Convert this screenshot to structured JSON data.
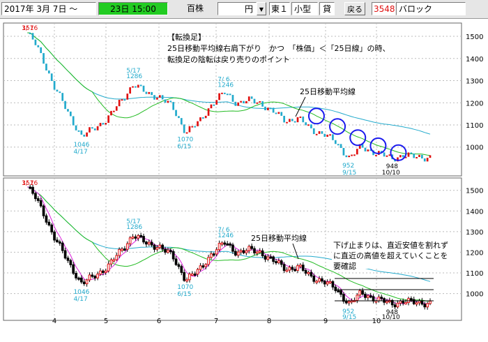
{
  "toolbar": {
    "date_text": "2017年  3月  7日 ～",
    "time_text": "23日 15:00",
    "time_bg": "#22cc22",
    "unit_label": "百株",
    "price_unit": "円",
    "dropdown_arrow": "▼",
    "market": "東１",
    "size_class": "小型",
    "lending": "貸",
    "back_button": "戻る",
    "code": "3548",
    "name": "バロック"
  },
  "colors": {
    "up": "#e01010",
    "down": "#22aacc",
    "ma25": "#22bb22",
    "ma75": "#22aacc",
    "ma5": "#dd22dd",
    "annotation": "#1a1aee",
    "grid": "#bbbbbb"
  },
  "panels": {
    "top": {
      "annotations": {
        "title": "【転換足】",
        "line1": "25日移動平均線右肩下がり　かつ　「株価」＜「25日線」の時、",
        "line2": "転換足の陰転は戻り売りのポイント",
        "ma_label": "25日移動平均線"
      },
      "labels": [
        {
          "text": "3/ 7",
          "color": "#e01010"
        },
        {
          "text": "1516",
          "color": "#e01010"
        },
        {
          "text": "5/17",
          "color": "#22aacc"
        },
        {
          "text": "1286",
          "color": "#22aacc"
        },
        {
          "text": "7/ 6",
          "color": "#22aacc"
        },
        {
          "text": "1246",
          "color": "#22aacc"
        },
        {
          "text": "1046",
          "color": "#22aacc"
        },
        {
          "text": "4/17",
          "color": "#22aacc"
        },
        {
          "text": "1070",
          "color": "#22aacc"
        },
        {
          "text": "6/15",
          "color": "#22aacc"
        },
        {
          "text": "952",
          "color": "#22aacc"
        },
        {
          "text": "9/15",
          "color": "#22aacc"
        },
        {
          "text": "948",
          "color": "#000000"
        },
        {
          "text": "10/10",
          "color": "#000000"
        }
      ]
    },
    "bottom": {
      "annotations": {
        "ma_label": "25日移動平均線",
        "note1": "下げ止まりは、直近安値を割れず",
        "note2": "に直近の高値を超えていくことを",
        "note3": "要確認"
      },
      "labels": [
        {
          "text": "3/ 7",
          "color": "#e01010"
        },
        {
          "text": "1516",
          "color": "#e01010"
        },
        {
          "text": "5/17",
          "color": "#22aacc"
        },
        {
          "text": "1286",
          "color": "#22aacc"
        },
        {
          "text": "7/ 6",
          "color": "#22aacc"
        },
        {
          "text": "1246",
          "color": "#22aacc"
        },
        {
          "text": "1046",
          "color": "#22aacc"
        },
        {
          "text": "4/17",
          "color": "#22aacc"
        },
        {
          "text": "1070",
          "color": "#22aacc"
        },
        {
          "text": "6/15",
          "color": "#22aacc"
        },
        {
          "text": "952",
          "color": "#22aacc"
        },
        {
          "text": "9/15",
          "color": "#22aacc"
        },
        {
          "text": "948",
          "color": "#000000"
        },
        {
          "text": "10/10",
          "color": "#000000"
        }
      ]
    }
  },
  "chart_data": {
    "type": "line",
    "ylim": [
      870,
      1560
    ],
    "y_ticks": [
      "1500",
      "1400",
      "1300",
      "1200",
      "1100",
      "1000"
    ],
    "x_ticks": [
      "4",
      "5",
      "6",
      "7",
      "8",
      "9",
      "10"
    ],
    "grid": true,
    "points": [
      {
        "date": "3/7",
        "value": 1516
      },
      {
        "date": "3/15",
        "value": 1460
      },
      {
        "date": "3/23",
        "value": 1380
      },
      {
        "date": "3/31",
        "value": 1280
      },
      {
        "date": "4/10",
        "value": 1140
      },
      {
        "date": "4/17",
        "value": 1046
      },
      {
        "date": "4/25",
        "value": 1090
      },
      {
        "date": "5/2",
        "value": 1130
      },
      {
        "date": "5/10",
        "value": 1210
      },
      {
        "date": "5/17",
        "value": 1286
      },
      {
        "date": "5/25",
        "value": 1240
      },
      {
        "date": "6/1",
        "value": 1230
      },
      {
        "date": "6/8",
        "value": 1180
      },
      {
        "date": "6/15",
        "value": 1070
      },
      {
        "date": "6/22",
        "value": 1110
      },
      {
        "date": "6/29",
        "value": 1200
      },
      {
        "date": "7/6",
        "value": 1246
      },
      {
        "date": "7/13",
        "value": 1200
      },
      {
        "date": "7/20",
        "value": 1210
      },
      {
        "date": "7/27",
        "value": 1200
      },
      {
        "date": "8/3",
        "value": 1160
      },
      {
        "date": "8/10",
        "value": 1120
      },
      {
        "date": "8/17",
        "value": 1130
      },
      {
        "date": "8/24",
        "value": 1080
      },
      {
        "date": "8/31",
        "value": 1060
      },
      {
        "date": "9/7",
        "value": 1020
      },
      {
        "date": "9/15",
        "value": 952
      },
      {
        "date": "9/22",
        "value": 1000
      },
      {
        "date": "9/29",
        "value": 980
      },
      {
        "date": "10/6",
        "value": 960
      },
      {
        "date": "10/10",
        "value": 948
      },
      {
        "date": "10/17",
        "value": 965
      },
      {
        "date": "10/23",
        "value": 955
      }
    ]
  }
}
